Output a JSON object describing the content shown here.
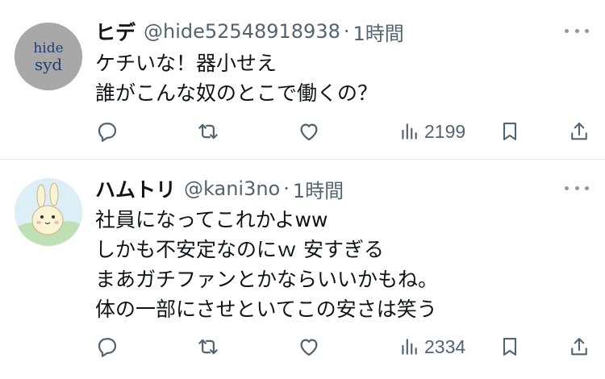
{
  "tweets": [
    {
      "name": "ヒデ",
      "handle": "@hide52548918938",
      "separator": "·",
      "time": "1時間",
      "avatar_text": [
        "hide",
        "syd"
      ],
      "lines": [
        "ケチいな！器小せえ",
        "誰がこんな奴のとこで働くの？"
      ],
      "views": "2199"
    },
    {
      "name": "ハムトリ",
      "handle": "@kani3no",
      "separator": "·",
      "time": "1時間",
      "lines": [
        "社員になってこれかよww",
        "しかも不安定なのにｗ 安すぎる",
        "まあガチファンとかならいいかもね。",
        "体の一部にさせといてこの安さは笑う"
      ],
      "views": "2334"
    }
  ],
  "icons": {
    "reply": "reply-icon",
    "retweet": "retweet-icon",
    "like": "heart-icon",
    "views": "views-icon",
    "bookmark": "bookmark-icon",
    "share": "share-icon",
    "more": "more-icon"
  },
  "colors": {
    "text": "#0f1419",
    "secondary": "#536471",
    "divider": "#e6e8eb"
  }
}
